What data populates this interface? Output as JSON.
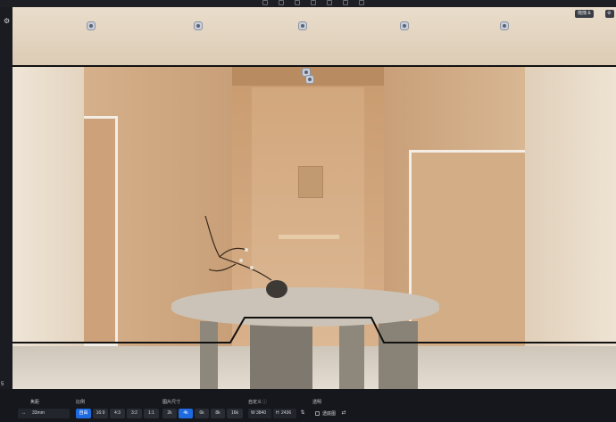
{
  "left_bar": {
    "index_label": "5"
  },
  "view_controls": {
    "view_label": "拖拽 &"
  },
  "bottom_panel": {
    "focal": {
      "label": "焦距",
      "value": "33mm"
    },
    "ratio": {
      "label": "比例",
      "options": [
        "自由",
        "16:9",
        "4:3",
        "3:2",
        "1:1"
      ],
      "selected": "自由"
    },
    "size": {
      "label": "图片尺寸",
      "options": [
        "2k",
        "4k",
        "6k",
        "8k",
        "16k"
      ],
      "selected": "4k"
    },
    "custom": {
      "label": "自定义",
      "width_prefix": "W",
      "width": "3840",
      "height_prefix": "H",
      "height": "2436"
    },
    "transparent": {
      "label": "透明",
      "option": "透底图"
    }
  },
  "colors": {
    "accent": "#1e6ae0"
  },
  "icons": [
    "gear-icon",
    "camera-pin-icon",
    "swap-icon",
    "info-icon"
  ]
}
